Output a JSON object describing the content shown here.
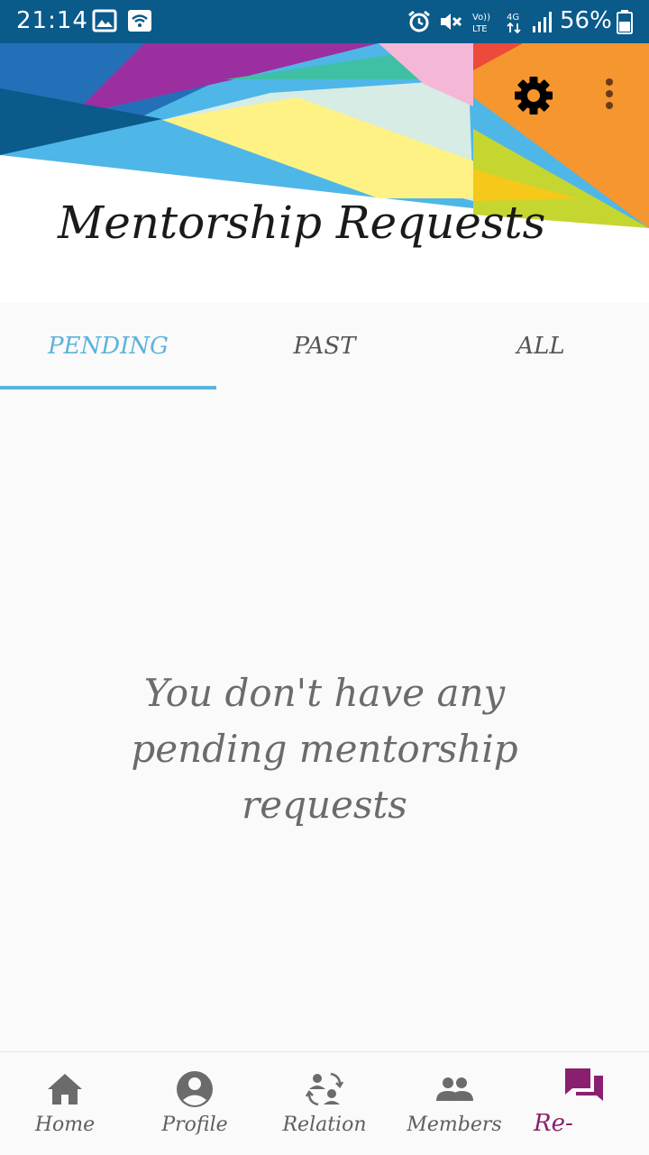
{
  "status_bar": {
    "time": "21:14",
    "battery_percent": "56%",
    "icons": [
      "image-icon",
      "wifi-icon",
      "alarm-icon",
      "mute-icon",
      "volte-icon",
      "4g-icon",
      "signal-icon",
      "battery-icon"
    ]
  },
  "header": {
    "title": "Mentorship Requests",
    "actions": [
      "settings-icon",
      "more-vert-icon"
    ]
  },
  "tabs": [
    {
      "label": "PENDING",
      "active": true
    },
    {
      "label": "PAST",
      "active": false
    },
    {
      "label": "ALL",
      "active": false
    }
  ],
  "empty_state": {
    "message": "You don't have any pending mentorship requests"
  },
  "bottom_nav": [
    {
      "label": "Home",
      "icon": "home-icon",
      "active": false
    },
    {
      "label": "Profile",
      "icon": "account-circle-icon",
      "active": false
    },
    {
      "label": "Relation",
      "icon": "relation-icon",
      "active": false
    },
    {
      "label": "Members",
      "icon": "people-icon",
      "active": false
    },
    {
      "label": "Re-",
      "icon": "forum-icon",
      "active": true
    }
  ],
  "colors": {
    "status_bar": "#0a5a8a",
    "accent_tab": "#5bb3dc",
    "active_nav": "#8a1f6f",
    "icon_gray": "#6b6b6b"
  }
}
